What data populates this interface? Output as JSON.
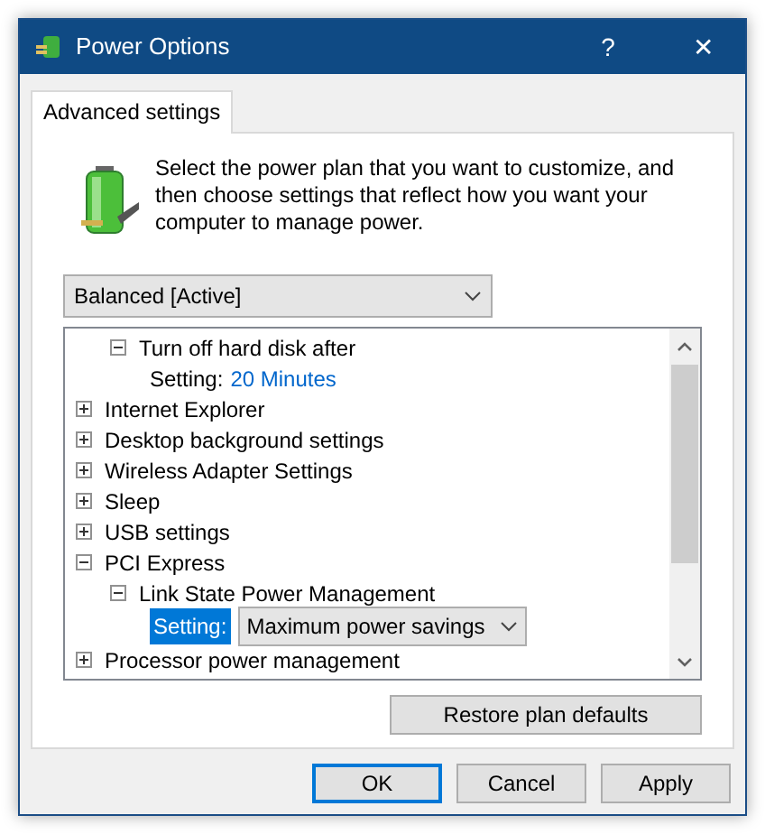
{
  "window": {
    "title": "Power Options",
    "help_button": "?",
    "close_button": "✕"
  },
  "tabs": [
    {
      "label": "Advanced settings",
      "selected": true
    }
  ],
  "description": "Select the power plan that you want to customize, and then choose settings that reflect how you want your computer to manage power.",
  "plan_select": {
    "value": "Balanced [Active]"
  },
  "tree": [
    {
      "children": [
        {
          "label": "Turn off hard disk after",
          "expanded": true,
          "children": [
            {
              "kind": "setting",
              "label": "Setting:",
              "value": "20 Minutes",
              "selected": false
            }
          ]
        }
      ]
    },
    {
      "label": "Internet Explorer",
      "expanded": false
    },
    {
      "label": "Desktop background settings",
      "expanded": false
    },
    {
      "label": "Wireless Adapter Settings",
      "expanded": false
    },
    {
      "label": "Sleep",
      "expanded": false
    },
    {
      "label": "USB settings",
      "expanded": false
    },
    {
      "label": "PCI Express",
      "expanded": true,
      "children": [
        {
          "label": "Link State Power Management",
          "expanded": true,
          "children": [
            {
              "kind": "setting-select",
              "label": "Setting:",
              "value": "Maximum power savings",
              "selected": true
            }
          ]
        }
      ]
    },
    {
      "label": "Processor power management",
      "expanded": false
    }
  ],
  "restore_button": "Restore plan defaults",
  "buttons": [
    {
      "label": "OK",
      "default": true
    },
    {
      "label": "Cancel",
      "default": false
    },
    {
      "label": "Apply",
      "default": false
    }
  ]
}
